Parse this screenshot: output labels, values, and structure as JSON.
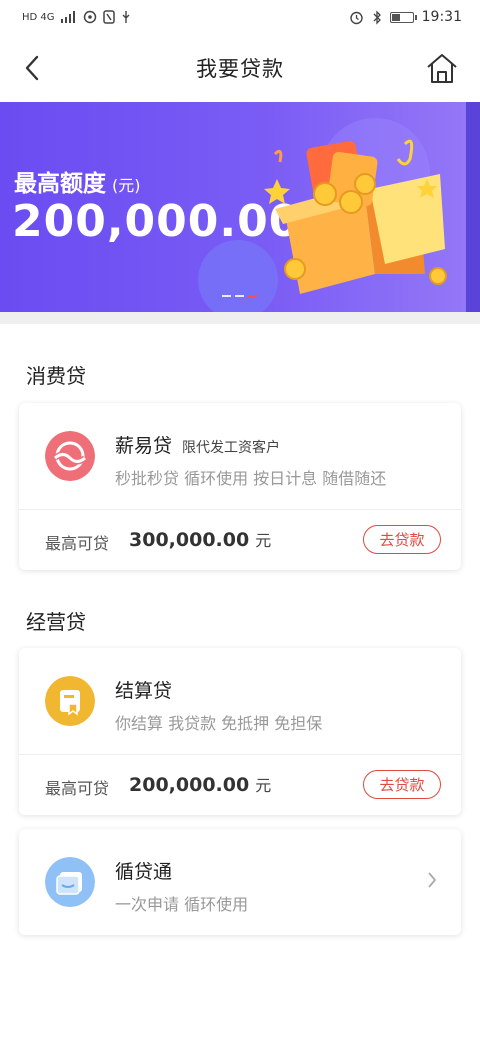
{
  "status_bar": {
    "left": "HD 4G",
    "time": "19:31"
  },
  "header": {
    "title": "我要贷款"
  },
  "banner": {
    "label": "最高额度",
    "unit": "(元)",
    "amount": "200,000.00"
  },
  "sections": [
    {
      "title": "消费贷",
      "product": {
        "name": "薪易贷",
        "tag": "限代发工资客户",
        "desc": "秒批秒贷 循环使用 按日计息 随借随还",
        "limit_label": "最高可贷",
        "limit_amount": "300,000.00",
        "limit_unit": "元",
        "button": "去贷款"
      }
    },
    {
      "title": "经营贷",
      "product": {
        "name": "结算贷",
        "desc": "你结算 我贷款 免抵押 免担保",
        "limit_label": "最高可贷",
        "limit_amount": "200,000.00",
        "limit_unit": "元",
        "button": "去贷款"
      }
    }
  ],
  "extra_product": {
    "name": "循贷通",
    "desc": "一次申请 循环使用"
  },
  "colors": {
    "banner": "#6a4cf2",
    "accent": "#e04a3f",
    "icon1": "#ef6f78",
    "icon2": "#f2b731",
    "icon3": "#8fc1f7"
  }
}
